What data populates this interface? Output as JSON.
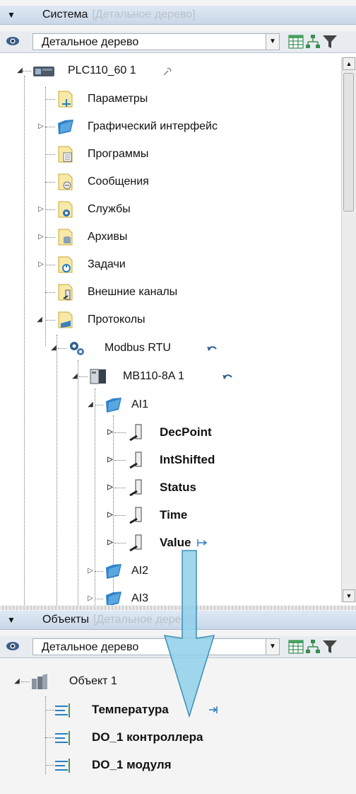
{
  "top_panel": {
    "header": {
      "title": "Система",
      "subtitle": "[Детальное дерево]"
    },
    "view_select": {
      "value": "Детальное дерево"
    },
    "tree": {
      "root": "PLC110_60 1",
      "items": [
        "Параметры",
        "Графический интерфейс",
        "Программы",
        "Сообщения",
        "Службы",
        "Архивы",
        "Задачи",
        "Внешние каналы",
        "Протоколы"
      ],
      "modbus": "Modbus RTU",
      "module": "MB110-8A 1",
      "ai1": "AI1",
      "vars": [
        "DecPoint",
        "IntShifted",
        "Status",
        "Time",
        "Value"
      ],
      "ai2": "AI2",
      "ai3": "AI3"
    }
  },
  "bottom_panel": {
    "header": {
      "title": "Объекты",
      "subtitle": "[Детальное дерево]"
    },
    "view_select": {
      "value": "Детальное дерево"
    },
    "tree": {
      "root": "Объект 1",
      "items": [
        "Температура",
        "DO_1 контроллера",
        "DO_1 модуля"
      ]
    }
  },
  "colors": {
    "header_bg": "#d3dfee",
    "folder": "#f3d46a",
    "blue_folder": "#2f83c8",
    "arrow": "#7fc8e6"
  }
}
